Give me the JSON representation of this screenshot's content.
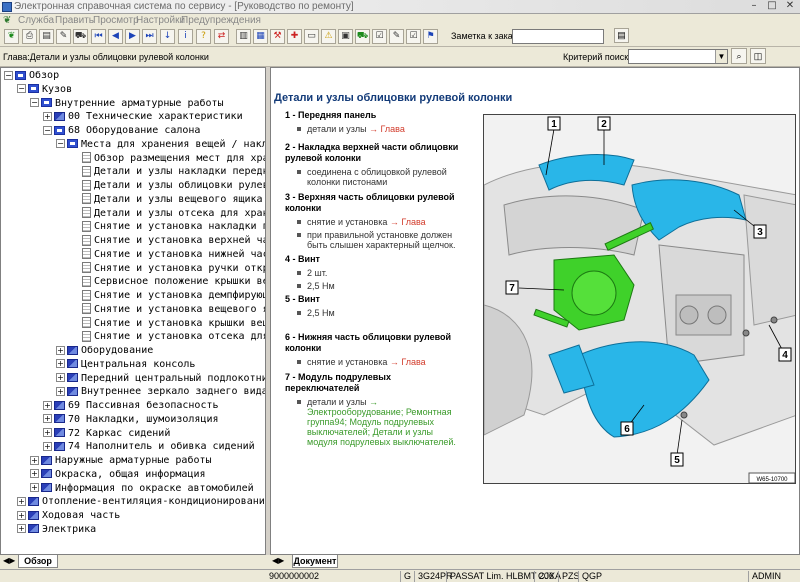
{
  "window": {
    "title": "Электронная справочная система по сервису - [Руководство по ремонту]",
    "controls": [
      "–",
      "□",
      "✕"
    ]
  },
  "menu": [
    "Служба",
    "Править",
    "Просмотр",
    "Настройки",
    "Предупреждения"
  ],
  "toolbar": {
    "order_label": "Заметка к заказу:",
    "order_value": ""
  },
  "breadcrumb": "Глава:Детали и узлы облицовки рулевой колонки",
  "criteria": {
    "label": "Критерий поиска:",
    "value": ""
  },
  "tree": [
    {
      "label": "Обзор",
      "level": 0,
      "toggle": "−",
      "icon": "open"
    },
    {
      "label": "Кузов",
      "level": 1,
      "toggle": "−",
      "icon": "open"
    },
    {
      "label": "Внутренние арматурные работы",
      "level": 2,
      "toggle": "−",
      "icon": "open"
    },
    {
      "label": "00 Технические характеристики",
      "level": 3,
      "toggle": "+",
      "icon": "book"
    },
    {
      "label": "68 Оборудование салона",
      "level": 3,
      "toggle": "−",
      "icon": "open"
    },
    {
      "label": "Места для хранения вещей / накладк",
      "level": 4,
      "toggle": "−",
      "icon": "open"
    },
    {
      "label": "Обзор размещения мест для хранени",
      "level": 5,
      "toggle": "",
      "icon": "doc"
    },
    {
      "label": "Детали и узлы накладки передней п",
      "level": 5,
      "toggle": "",
      "icon": "doc"
    },
    {
      "label": "Детали и узлы облицовки рулевой к",
      "level": 5,
      "toggle": "",
      "icon": "doc"
    },
    {
      "label": "Детали и узлы вещевого ящика",
      "level": 5,
      "toggle": "",
      "icon": "doc"
    },
    {
      "label": "Детали и узлы отсека для хранения",
      "level": 5,
      "toggle": "",
      "icon": "doc"
    },
    {
      "label": "Снятие и установка накладки перед",
      "level": 5,
      "toggle": "",
      "icon": "doc"
    },
    {
      "label": "Снятие и установка верхней части о",
      "level": 5,
      "toggle": "",
      "icon": "doc"
    },
    {
      "label": "Снятие и установка нижней части об",
      "level": 5,
      "toggle": "",
      "icon": "doc"
    },
    {
      "label": "Снятие и установка ручки открыван",
      "level": 5,
      "toggle": "",
      "icon": "doc"
    },
    {
      "label": "Сервисное положение крышки вещев",
      "level": 5,
      "toggle": "",
      "icon": "doc"
    },
    {
      "label": "Снятие и установка демпфирующего",
      "level": 5,
      "toggle": "",
      "icon": "doc"
    },
    {
      "label": "Снятие и установка вещевого ящика",
      "level": 5,
      "toggle": "",
      "icon": "doc"
    },
    {
      "label": "Снятие и установка крышки вещевог",
      "level": 5,
      "toggle": "",
      "icon": "doc"
    },
    {
      "label": "Снятие и установка отсека для хра",
      "level": 5,
      "toggle": "",
      "icon": "doc"
    },
    {
      "label": "Оборудование",
      "level": 4,
      "toggle": "+",
      "icon": "book"
    },
    {
      "label": "Центральная консоль",
      "level": 4,
      "toggle": "+",
      "icon": "book"
    },
    {
      "label": "Передний центральный подлокотник",
      "level": 4,
      "toggle": "+",
      "icon": "book"
    },
    {
      "label": "Внутреннее зеркало заднего вида",
      "level": 4,
      "toggle": "+",
      "icon": "book"
    },
    {
      "label": "69 Пассивная безопасность",
      "level": 3,
      "toggle": "+",
      "icon": "book"
    },
    {
      "label": "70 Накладки, шумоизоляция",
      "level": 3,
      "toggle": "+",
      "icon": "book"
    },
    {
      "label": "72 Каркас сидений",
      "level": 3,
      "toggle": "+",
      "icon": "book"
    },
    {
      "label": "74 Наполнитель и обивка сидений",
      "level": 3,
      "toggle": "+",
      "icon": "book"
    },
    {
      "label": "Наружные арматурные работы",
      "level": 2,
      "toggle": "+",
      "icon": "book"
    },
    {
      "label": "Окраска, общая информация",
      "level": 2,
      "toggle": "+",
      "icon": "book"
    },
    {
      "label": "Информация по окраске автомобилей",
      "level": 2,
      "toggle": "+",
      "icon": "book"
    },
    {
      "label": "Отопление-вентиляция-кондиционирование",
      "level": 1,
      "toggle": "+",
      "icon": "book"
    },
    {
      "label": "Ходовая часть",
      "level": 1,
      "toggle": "+",
      "icon": "book"
    },
    {
      "label": "Электрика",
      "level": 1,
      "toggle": "+",
      "icon": "book"
    }
  ],
  "left_tab": "Обзор",
  "right_tab": "Документ",
  "doc": {
    "title": "Детали и узлы облицовки рулевой колонки",
    "items": [
      {
        "num": "1 -",
        "title": "Передняя панель",
        "subs": [
          {
            "text": "детали и узлы ",
            "link": "→ Глава",
            "link_color": "red"
          }
        ]
      },
      {
        "num": "2 -",
        "title": "Накладка верхней части облицовки рулевой колонки",
        "subs": [
          {
            "text": "соединена с облицовкой рулевой колонки пистонами",
            "link": "",
            "link_color": ""
          }
        ]
      },
      {
        "num": "3 -",
        "title": "Верхняя часть облицовки рулевой колонки",
        "subs": [
          {
            "text": "снятие и установка ",
            "link": "→ Глава",
            "link_color": "red"
          },
          {
            "text": "при правильной установке должен быть слышен характерный щелчок.",
            "link": "",
            "link_color": ""
          }
        ]
      },
      {
        "num": "4 -",
        "title": "Винт",
        "subs": [
          {
            "text": "2 шт.",
            "link": "",
            "link_color": ""
          },
          {
            "text": "2,5 Нм",
            "link": "",
            "link_color": ""
          }
        ]
      },
      {
        "num": "5 -",
        "title": "Винт",
        "subs": [
          {
            "text": "2,5 Нм",
            "link": "",
            "link_color": ""
          }
        ]
      },
      {
        "num": "6 -",
        "title": "Нижняя часть облицовки рулевой колонки",
        "subs": [
          {
            "text": "снятие и установка ",
            "link": "→ Глава",
            "link_color": "red"
          }
        ]
      },
      {
        "num": "7 -",
        "title": "Модуль подрулевых переключателей",
        "subs": [
          {
            "text": "детали и узлы ",
            "link": "→ Электрооборудование; Ремонтная группа94; Модуль подрулевых выключателей; Детали и узлы модуля подрулевых выключателей.",
            "link_color": "green"
          }
        ]
      }
    ],
    "figure_code": "W65-10700",
    "callouts": [
      "1",
      "2",
      "3",
      "4",
      "5",
      "6",
      "7"
    ]
  },
  "status": [
    "9000000002",
    "G",
    "3G24PR",
    "PASSAT Lim. HLBMT 206",
    "CJXA",
    "PZS",
    "QGP",
    "ADMIN"
  ],
  "colors": {
    "accent": "#123a78",
    "link_red": "#d23c2c",
    "link_green": "#3a9a2a",
    "cyan_part": "#29b6e8",
    "green_part": "#3fd12a"
  }
}
